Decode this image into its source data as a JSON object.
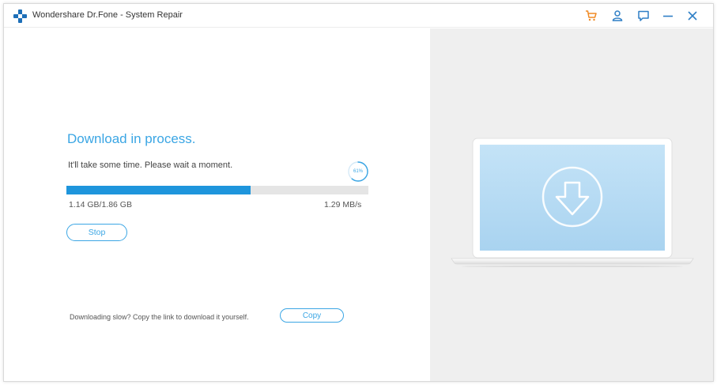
{
  "window": {
    "title": "Wondershare Dr.Fone - System Repair",
    "accent_color": "#3ba6e4",
    "cart_color": "#f08a24"
  },
  "titlebar": {
    "icons": [
      "drfone-logo-icon",
      "cart-icon",
      "account-icon",
      "feedback-icon",
      "minimize-icon",
      "close-icon"
    ]
  },
  "download": {
    "heading": "Download in process.",
    "subtitle": "It'll take some time. Please wait a moment.",
    "percent_label": "61%",
    "progress_fraction": 0.61,
    "size_text": "1.14 GB/1.86 GB",
    "speed_text": "1.29 MB/s",
    "stop_label": "Stop"
  },
  "footer": {
    "slow_text": "Downloading slow? Copy the link to download it yourself.",
    "copy_label": "Copy"
  },
  "illustration": {
    "icon": "download-arrow-icon",
    "screen_color": "#b9dcf4"
  }
}
